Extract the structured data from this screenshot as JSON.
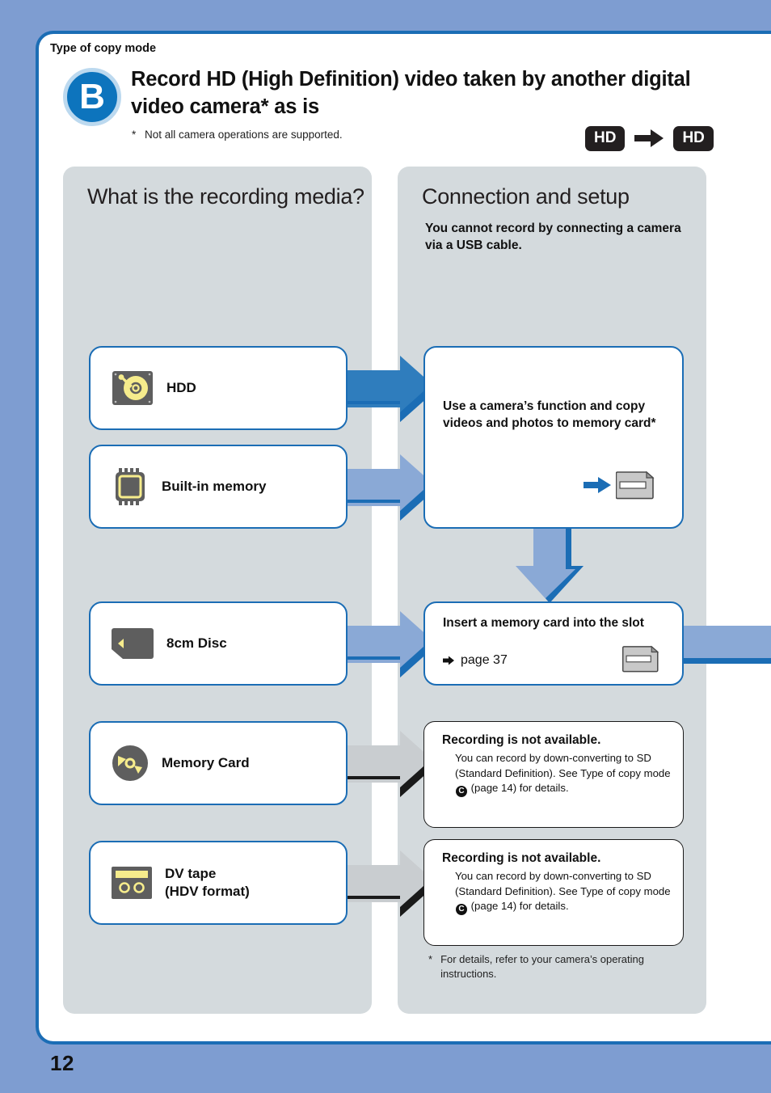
{
  "page": {
    "kicker": "Type of copy mode",
    "mode_letter": "B",
    "title": "Record HD (High Definition) video taken by another digital video camera* as is",
    "title_note_marker": "*",
    "title_note": "Not all camera operations are supported.",
    "page_number": "12",
    "format_badges": {
      "from": "HD",
      "to": "HD",
      "arrow_icon": "right-arrow-icon"
    }
  },
  "left_panel": {
    "title": "What is the recording media?",
    "media": [
      {
        "label": "HDD",
        "icon": "hdd-icon"
      },
      {
        "label": "Built-in memory",
        "icon": "memory-chip-icon"
      },
      {
        "label": "8cm Disc",
        "icon": "disc-icon"
      },
      {
        "label": "Memory Card",
        "icon": "memory-card-disc-icon"
      },
      {
        "label": "DV tape\n(HDV format)",
        "label_line1": "DV tape",
        "label_line2": "(HDV format)",
        "icon": "dv-tape-icon"
      }
    ]
  },
  "right_panel": {
    "title": "Connection and setup",
    "subtitle": "You cannot record by connecting a camera via a USB cable.",
    "use_camera_box": {
      "text": "Use a camera’s function and copy videos and photos to memory card*",
      "icon": "memory-card-insert-icon"
    },
    "insert_box": {
      "title": "Insert a memory card into the slot",
      "link_label": "page 37",
      "link_arrow_icon": "right-arrow-small-icon",
      "icon": "memory-card-icon"
    },
    "notices": [
      {
        "title": "Recording is not available.",
        "body_part1": "You can record by down-converting to SD (Standard Definition). See Type of copy mode ",
        "mark": "C",
        "body_part2": " (page 14) for details."
      },
      {
        "title": "Recording is not available.",
        "body_part1": "You can record by down-converting to SD (Standard Definition). See Type of copy mode ",
        "mark": "C",
        "body_part2": " (page 14) for details."
      }
    ],
    "footnote_marker": "*",
    "footnote": "For details, refer to your camera’s operating instructions."
  },
  "colors": {
    "page_background": "#7e9dd1",
    "panel_gray": "#d4dadd",
    "border_blue": "#1b6db5",
    "badge_blue": "#0d74bd",
    "arrow_blue_dark": "#2f7dbd",
    "arrow_blue_light": "#8aa9d6",
    "arrow_gray": "#c9cdd0",
    "icon_gray": "#5e5e5e",
    "icon_yellow": "#f6ec8c",
    "chip_black": "#231f20"
  }
}
